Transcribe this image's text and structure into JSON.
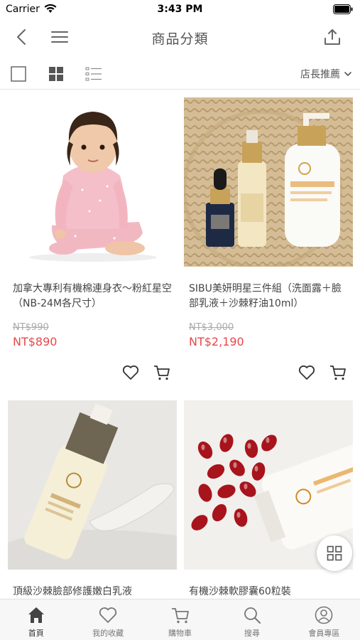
{
  "status_bar": {
    "carrier": "Carrier",
    "time": "3:43 PM"
  },
  "nav": {
    "title": "商品分類"
  },
  "toolbar": {
    "sort_label": "店長推薦"
  },
  "products": [
    {
      "name": "加拿大專利有機棉連身衣～粉紅星空（NB-24M各尺寸）",
      "old_price": "NT$990",
      "price": "NT$890"
    },
    {
      "name": "SIBU美妍明星三件組（洗面露＋臉部乳液＋沙棘籽油10ml）",
      "old_price": "NT$3,000",
      "price": "NT$2,190"
    },
    {
      "name": "頂級沙棘臉部修護嫩白乳液",
      "old_price": "",
      "price": ""
    },
    {
      "name": "有機沙棘軟膠囊60粒裝",
      "old_price": "",
      "price": ""
    }
  ],
  "tabs": [
    {
      "label": "首頁",
      "icon": "home-icon"
    },
    {
      "label": "我的收藏",
      "icon": "heart-icon"
    },
    {
      "label": "購物車",
      "icon": "cart-icon"
    },
    {
      "label": "搜尋",
      "icon": "search-icon"
    },
    {
      "label": "會員專區",
      "icon": "user-icon"
    }
  ],
  "colors": {
    "price_red": "#e8474b",
    "text": "#444444",
    "tab_bg": "#f7f7f7"
  }
}
